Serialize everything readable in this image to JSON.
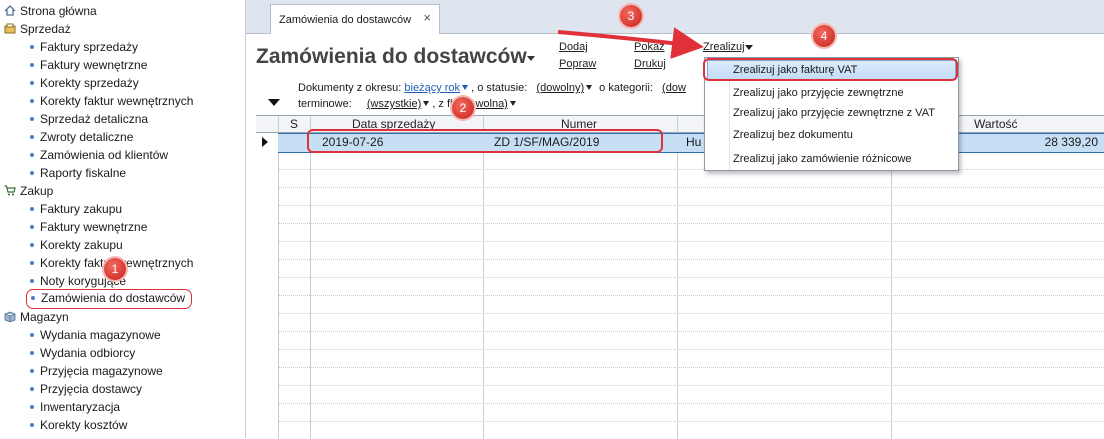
{
  "sidebar": {
    "groups": [
      {
        "label": "Strona główna"
      },
      {
        "label": "Sprzedaż"
      },
      {
        "label": "Zakup"
      },
      {
        "label": "Magazyn"
      }
    ],
    "sprzedaz_items": [
      "Faktury sprzedaży",
      "Faktury wewnętrzne",
      "Korekty sprzedaży",
      "Korekty faktur wewnętrznych",
      "Sprzedaż detaliczna",
      "Zwroty detaliczne",
      "Zamówienia od klientów",
      "Raporty fiskalne"
    ],
    "zakup_items": [
      "Faktury zakupu",
      "Faktury wewnętrzne",
      "Korekty zakupu",
      "Korekty faktur wewnętrznych",
      "Noty korygujące",
      "Zamówienia do dostawców"
    ],
    "magazyn_items": [
      "Wydania magazynowe",
      "Wydania odbiorcy",
      "Przyjęcia magazynowe",
      "Przyjęcia dostawcy",
      "Inwentaryzacja",
      "Korekty kosztów"
    ]
  },
  "tab": {
    "label": "Zamówienia do dostawców",
    "close": "×"
  },
  "page": {
    "title": "Zamówienia do dostawców"
  },
  "toolbar": {
    "dodaj": "Dodaj",
    "popraw": "Popraw",
    "pokaz": "Pokaż",
    "drukuj": "Drukuj",
    "zrealizuj": "Zrealizuj"
  },
  "filters": {
    "okres_label": "Dokumenty z okresu:",
    "okres_value": "bieżący rok",
    "status_label": ", o statusie:",
    "status_value": "(dowolny)",
    "kategoria_label": "o kategorii:",
    "kategoria_value": "(dow",
    "terminowe_label": "terminowe:",
    "terminowe_value": "(wszystkie)",
    "flaga_label": ", z fl",
    "flaga_value": "(dowolna)"
  },
  "table": {
    "columns": [
      "S",
      "Data sprzedaży",
      "Numer",
      "Wartość"
    ],
    "rows": [
      {
        "data": "2019-07-26",
        "numer": "ZD 1/SF/MAG/2019",
        "kontrahent": "Hu",
        "wartosc": "28 339,20"
      }
    ]
  },
  "menu": {
    "items": [
      "Zrealizuj jako fakturę VAT",
      "Zrealizuj jako przyjęcie zewnętrzne",
      "Zrealizuj jako przyjęcie zewnętrzne z VAT",
      "Zrealizuj bez dokumentu",
      "Zrealizuj jako zamówienie różnicowe"
    ]
  },
  "annotations": [
    "1",
    "2",
    "3",
    "4"
  ],
  "colors": {
    "accent_red": "#e0303a",
    "selection": "#c7dff5",
    "link_blue": "#1f5fb7"
  }
}
